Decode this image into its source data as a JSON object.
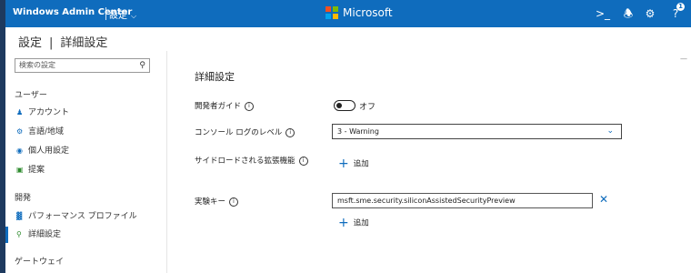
{
  "app": {
    "title": "Windows Admin Center",
    "menu_label": "設定",
    "brand": "Microsoft"
  },
  "header": {
    "notification_count": "1"
  },
  "breadcrumb": {
    "root": "設定",
    "current": "詳細設定"
  },
  "search": {
    "placeholder": "検索の設定"
  },
  "sidebar": {
    "groups": [
      {
        "label": "ユーザー",
        "items": [
          {
            "label": "アカウント",
            "icon": "person-icon"
          },
          {
            "label": "言語/地域",
            "icon": "gear-icon"
          },
          {
            "label": "個人用設定",
            "icon": "palette-icon"
          },
          {
            "label": "提案",
            "icon": "lightbulb-icon"
          }
        ]
      },
      {
        "label": "開発",
        "items": [
          {
            "label": "パフォーマンス プロファイル",
            "icon": "chart-icon"
          },
          {
            "label": "詳細設定",
            "icon": "key-icon"
          }
        ]
      },
      {
        "label": "ゲートウェイ",
        "items": []
      }
    ],
    "active_item": "詳細設定"
  },
  "main": {
    "heading": "詳細設定",
    "developer_guide": {
      "label": "開発者ガイド",
      "state": "オフ"
    },
    "console_log_level": {
      "label": "コンソール ログのレベル",
      "value": "3 - Warning"
    },
    "sideload": {
      "label": "サイドロードされる拡張機能",
      "add_label": "追加"
    },
    "experiment_key": {
      "label": "実験キー",
      "value": "msft.sme.security.siliconAssistedSecurityPreview",
      "add_label": "追加"
    }
  },
  "colors": {
    "accent": "#0f6cbd",
    "toggle": "#222222"
  }
}
